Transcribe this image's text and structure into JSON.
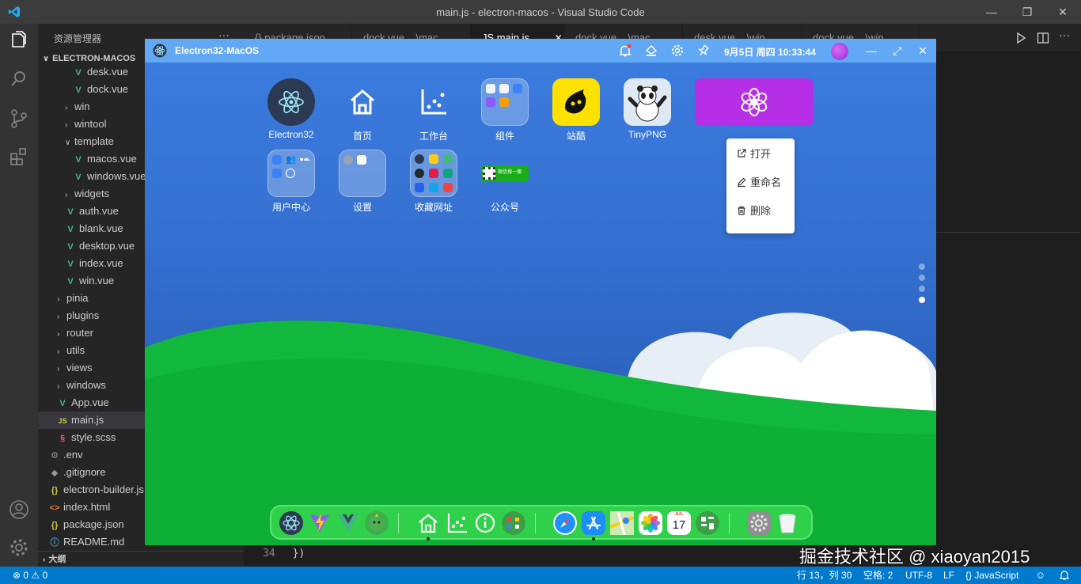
{
  "vscode": {
    "title": "main.js - electron-macos - Visual Studio Code",
    "sidebar": {
      "header": "资源管理器",
      "project": "ELECTRON-MACOS",
      "items": [
        {
          "label": "desk.vue",
          "type": "vue",
          "indent": 2
        },
        {
          "label": "dock.vue",
          "type": "vue",
          "indent": 2
        },
        {
          "label": "win",
          "type": "folder",
          "indent": 1
        },
        {
          "label": "wintool",
          "type": "folder",
          "indent": 1
        },
        {
          "label": "template",
          "type": "folder-open",
          "indent": 1
        },
        {
          "label": "macos.vue",
          "type": "vue",
          "indent": 2
        },
        {
          "label": "windows.vue",
          "type": "vue",
          "indent": 2
        },
        {
          "label": "widgets",
          "type": "folder",
          "indent": 1
        },
        {
          "label": "auth.vue",
          "type": "vue",
          "indent": 1
        },
        {
          "label": "blank.vue",
          "type": "vue",
          "indent": 1
        },
        {
          "label": "desktop.vue",
          "type": "vue",
          "indent": 1
        },
        {
          "label": "index.vue",
          "type": "vue",
          "indent": 1
        },
        {
          "label": "win.vue",
          "type": "vue",
          "indent": 1
        },
        {
          "label": "pinia",
          "type": "folder",
          "indent": 0
        },
        {
          "label": "plugins",
          "type": "folder",
          "indent": 0
        },
        {
          "label": "router",
          "type": "folder",
          "indent": 0
        },
        {
          "label": "utils",
          "type": "folder",
          "indent": 0
        },
        {
          "label": "views",
          "type": "folder",
          "indent": 0
        },
        {
          "label": "windows",
          "type": "folder",
          "indent": 0
        },
        {
          "label": "App.vue",
          "type": "vue",
          "indent": 0
        },
        {
          "label": "main.js",
          "type": "js",
          "indent": 0,
          "active": true
        },
        {
          "label": "style.scss",
          "type": "scss",
          "indent": 0
        },
        {
          "label": ".env",
          "type": "gear",
          "indent": -1
        },
        {
          "label": ".gitignore",
          "type": "git",
          "indent": -1
        },
        {
          "label": "electron-builder.js",
          "type": "json",
          "indent": -1
        },
        {
          "label": "index.html",
          "type": "html",
          "indent": -1
        },
        {
          "label": "package.json",
          "type": "json",
          "indent": -1
        },
        {
          "label": "README.md",
          "type": "info",
          "indent": -1
        }
      ],
      "outline": "大纲"
    },
    "tabs": [
      {
        "label": "{} package.json"
      },
      {
        "label": "dock.vue ...\\mac"
      },
      {
        "label": "JS main.js",
        "active": true
      },
      {
        "label": "dock.vue ...\\mac"
      },
      {
        "label": "desk.vue ...\\win"
      },
      {
        "label": "dock.vue ...\\win"
      }
    ],
    "code": {
      "line_no": "34",
      "text": "})"
    },
    "status": {
      "problems": "⊗ 0 ⚠ 0",
      "position": "行 13，列 30",
      "spaces": "空格: 2",
      "encoding": "UTF-8",
      "eol": "LF",
      "language": "{} JavaScript"
    }
  },
  "electron": {
    "title": "Electron32-MacOS",
    "datetime": "9月5日 周四 10:33:44",
    "apps_row1": [
      {
        "label": "Electron32",
        "icon": "electron-icon"
      },
      {
        "label": "首页",
        "icon": "home-icon"
      },
      {
        "label": "工作台",
        "icon": "chart-icon"
      },
      {
        "label": "组件",
        "icon": "components-icon"
      },
      {
        "label": "站酷",
        "icon": "zcool-icon"
      },
      {
        "label": "TinyPNG",
        "icon": "panda-icon"
      },
      {
        "label": "",
        "icon": "chatgpt-icon"
      }
    ],
    "apps_row2": [
      {
        "label": "用户中心",
        "icon": "user-center-icon"
      },
      {
        "label": "设置",
        "icon": "settings-icon"
      },
      {
        "label": "收藏网址",
        "icon": "bookmarks-icon"
      },
      {
        "label": "公众号",
        "icon": "wechat-icon"
      }
    ],
    "wechat_text": "微信搜一搜",
    "context_menu": [
      {
        "label": "打开",
        "icon": "external-link-icon"
      },
      {
        "label": "重命名",
        "icon": "edit-icon"
      },
      {
        "label": "删除",
        "icon": "trash-icon"
      }
    ],
    "page_count": 4,
    "active_page": 4,
    "dock": [
      "electron-icon",
      "vite-icon",
      "vue-icon",
      "pinia-icon",
      "home-icon",
      "chart-icon",
      "info-icon",
      "tools-icon",
      "safari-icon",
      "appstore-icon",
      "maps-icon",
      "photos-icon",
      "calendar-icon",
      "widgets-icon",
      "settings-icon",
      "trash-icon"
    ],
    "calendar": {
      "month": "JUL",
      "day": "17"
    }
  },
  "watermark": "掘金技术社区 @ xiaoyan2015"
}
